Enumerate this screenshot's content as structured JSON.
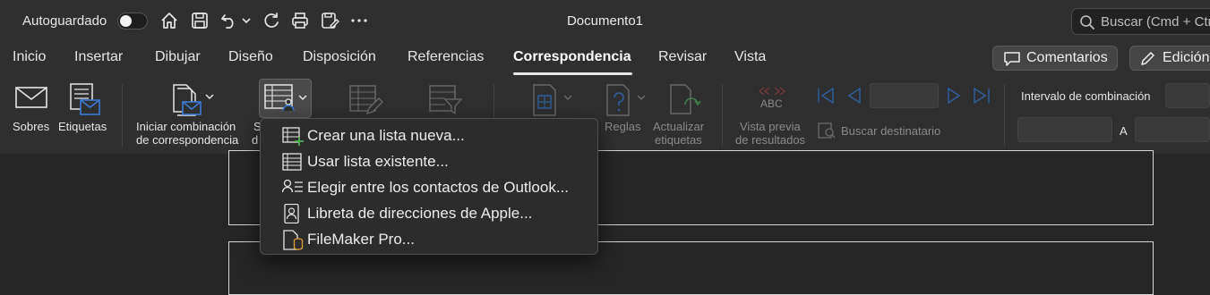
{
  "titlebar": {
    "autosave_label": "Autoguardado",
    "document_title": "Documento1",
    "search_placeholder": "Buscar (Cmd + Ctrl + U)",
    "quick_access_icons": [
      "home-icon",
      "save-icon",
      "undo-icon",
      "chevron-down-icon",
      "redo-icon",
      "print-icon",
      "save-as-icon",
      "more-icon"
    ]
  },
  "tabs": [
    "Inicio",
    "Insertar",
    "Dibujar",
    "Diseño",
    "Disposición",
    "Referencias",
    "Correspondencia",
    "Revisar",
    "Vista"
  ],
  "active_tab": "Correspondencia",
  "header_buttons": {
    "comments": "Comentarios",
    "editing": "Edición"
  },
  "ribbon": {
    "sobres": "Sobres",
    "etiquetas": "Etiquetas",
    "iniciar_line1": "Iniciar combinación",
    "iniciar_line2": "de correspondencia",
    "seleccionar_line1": "S",
    "seleccionar_line2": "d",
    "reglas": "Reglas",
    "actualizar_line1": "Actualizar",
    "actualizar_line2": "etiquetas",
    "vista_line1": "Vista previa",
    "vista_line2": "de resultados",
    "abc": "ABC",
    "buscar_destinatario": "Buscar destinatario",
    "intervalo": "Intervalo de combinación",
    "range_to": "A"
  },
  "dropdown": {
    "items": [
      {
        "label": "Crear una lista nueva...",
        "icon": "new-list-icon"
      },
      {
        "label": "Usar lista existente...",
        "icon": "existing-list-icon"
      },
      {
        "label": "Elegir entre los contactos de Outlook...",
        "icon": "outlook-contacts-icon"
      },
      {
        "label": "Libreta de direcciones de Apple...",
        "icon": "apple-address-book-icon"
      },
      {
        "label": "FileMaker Pro...",
        "icon": "filemaker-icon"
      }
    ]
  },
  "colors": {
    "background": "#262626",
    "toolbar": "#2f2f2f",
    "accent_blue": "#3a7bd5",
    "disabled_blue": "#2f5f9a"
  }
}
